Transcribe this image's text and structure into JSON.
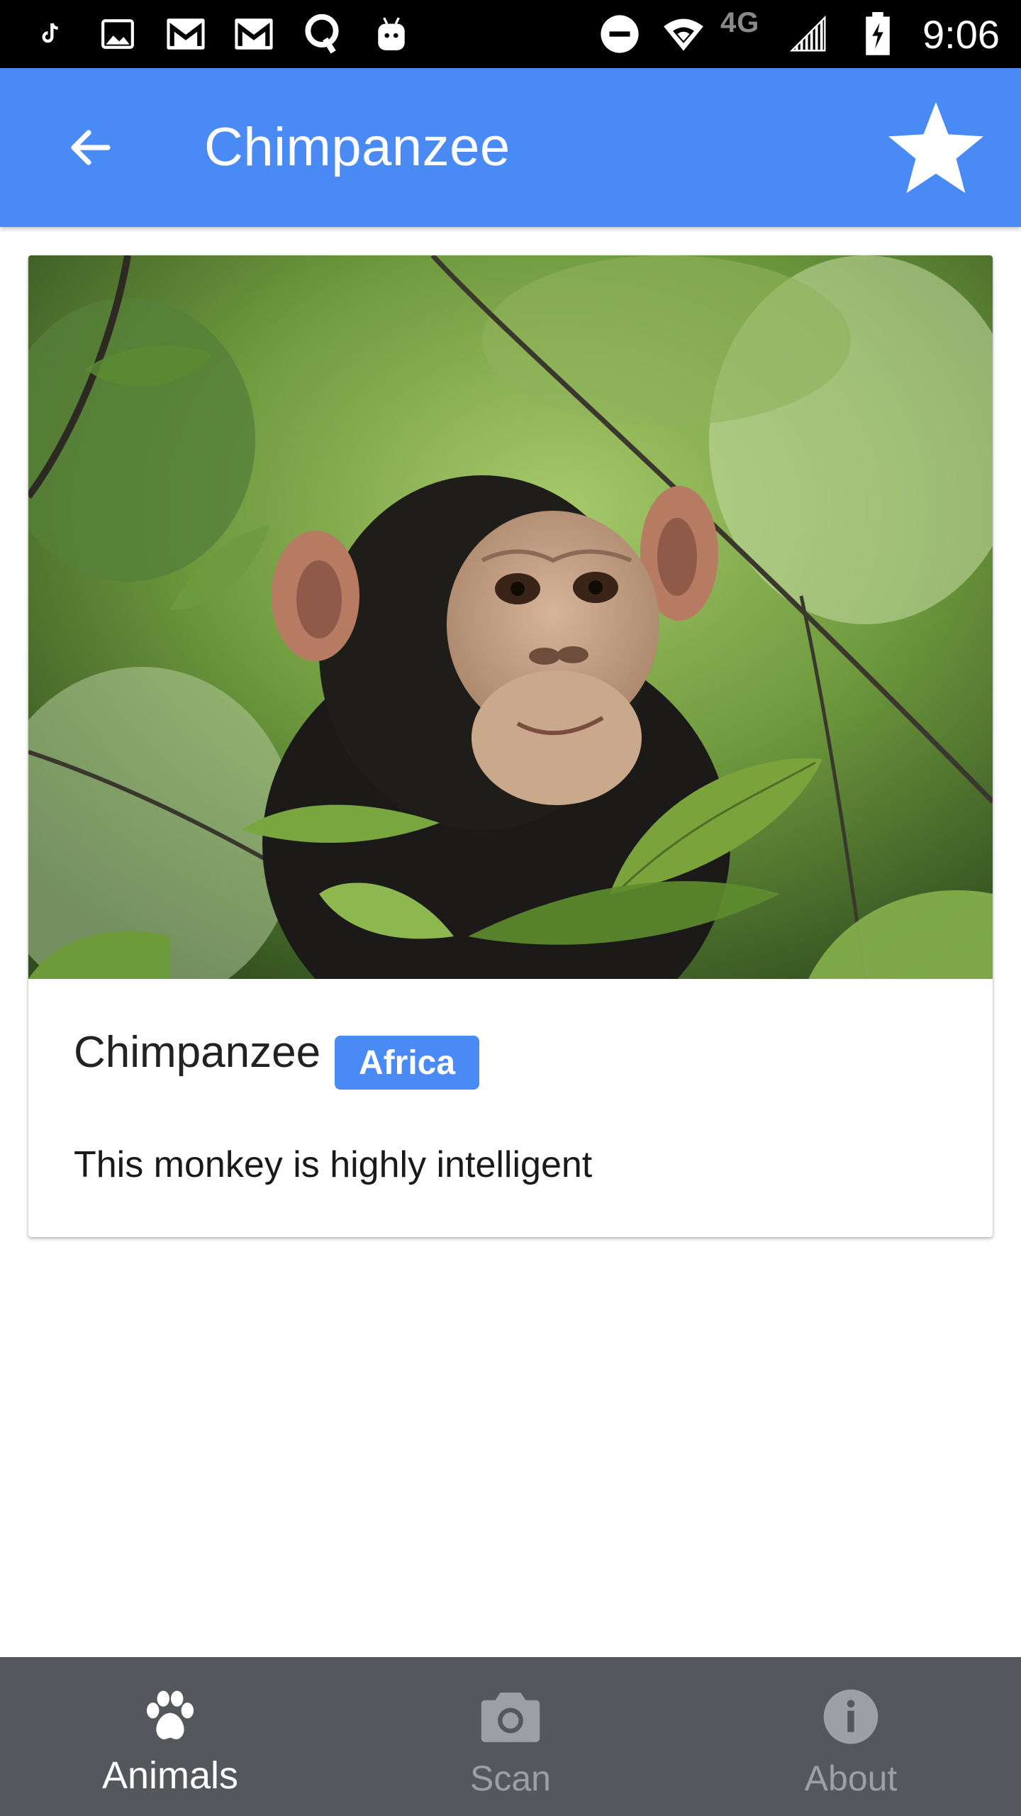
{
  "status_bar": {
    "time": "9:06",
    "network": "4G",
    "icons": [
      "tiktok-icon",
      "image-icon",
      "gmail-icon",
      "gmail-icon",
      "q-icon",
      "android-icon",
      "do-not-disturb-icon",
      "wifi-icon",
      "signal-icon",
      "battery-charging-icon"
    ]
  },
  "app_bar": {
    "title": "Chimpanzee",
    "back_icon": "arrow-back-icon",
    "favorite_icon": "star-icon",
    "color": "#4a8af4"
  },
  "card": {
    "image_subject": "chimpanzee among green leaves",
    "name": "Chimpanzee",
    "region": "Africa",
    "description": "This monkey is highly intelligent"
  },
  "bottom_nav": {
    "items": [
      {
        "label": "Animals",
        "icon": "paw-icon",
        "active": true
      },
      {
        "label": "Scan",
        "icon": "camera-icon",
        "active": false
      },
      {
        "label": "About",
        "icon": "info-icon",
        "active": false
      }
    ],
    "background": "#54575b"
  }
}
